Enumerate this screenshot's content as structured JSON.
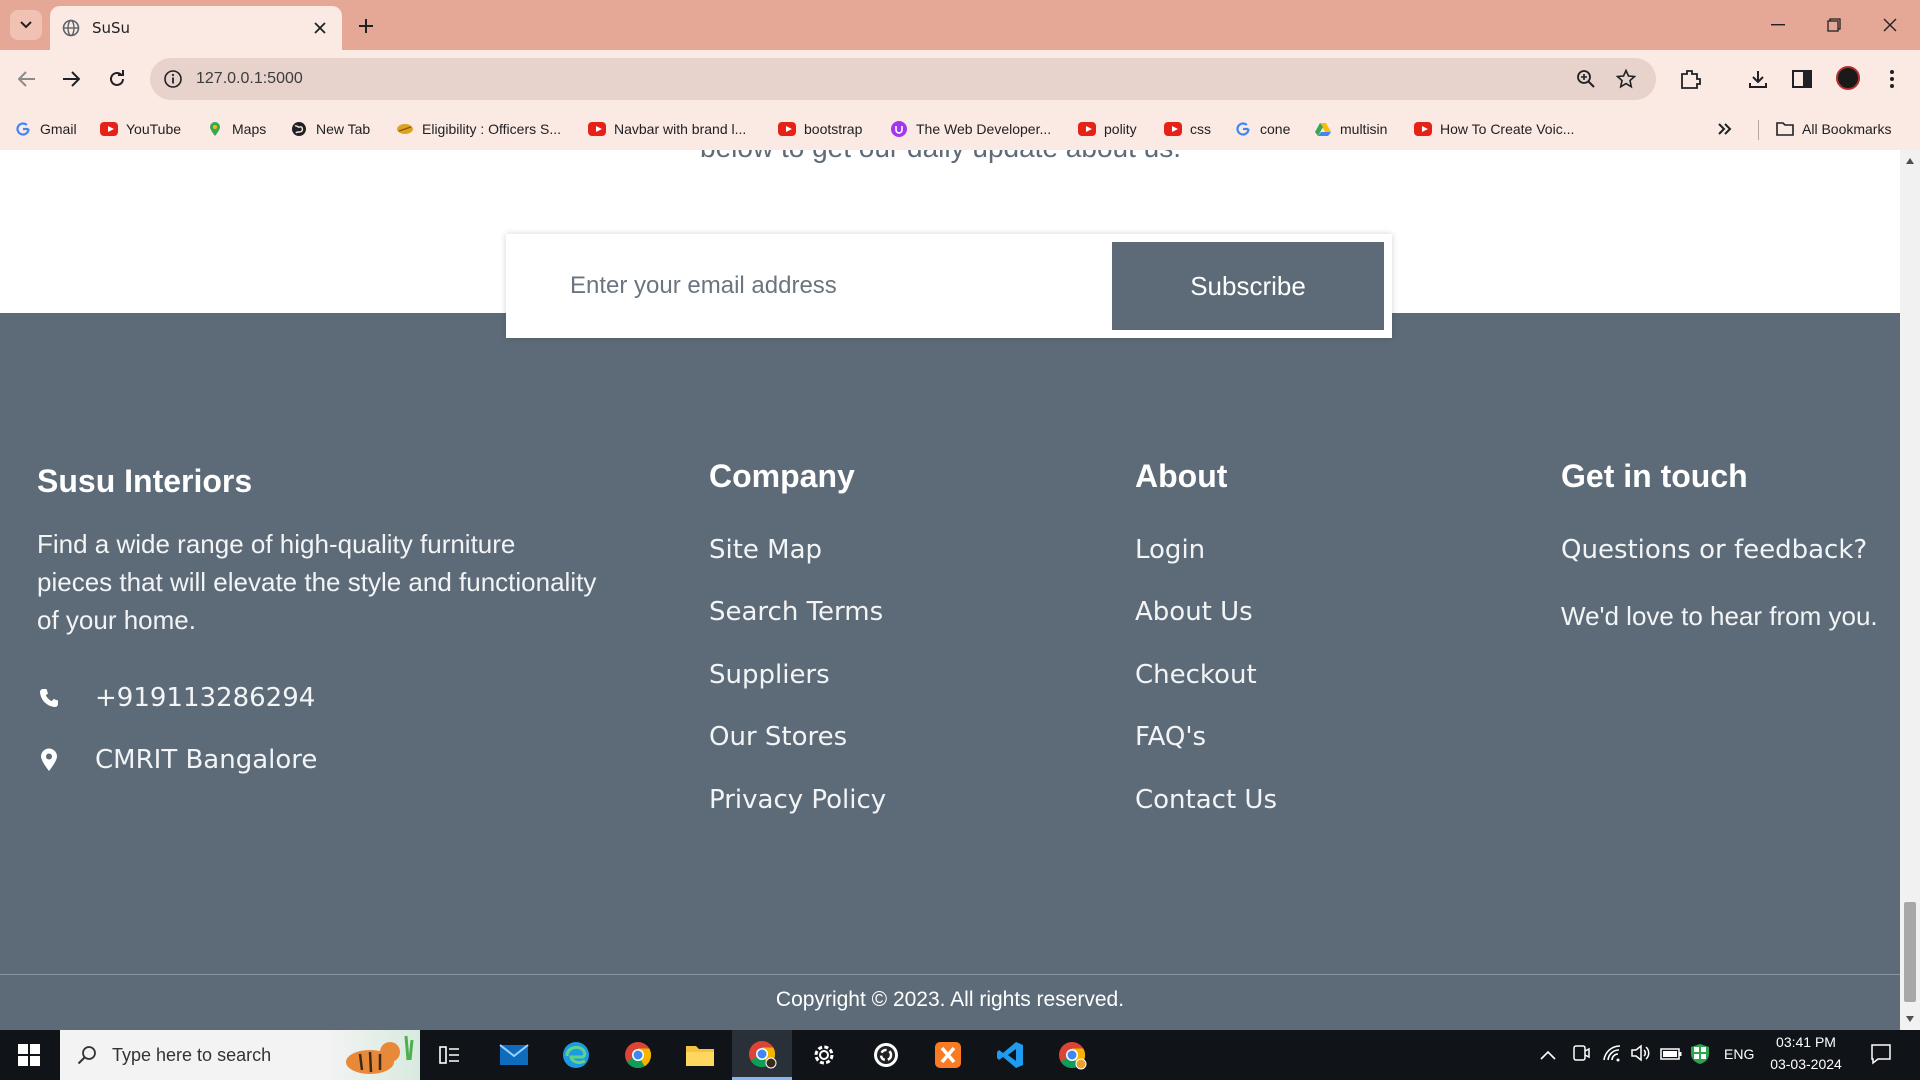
{
  "browser": {
    "tab_title": "SuSu",
    "url": "127.0.0.1:5000",
    "bookmarks": [
      "Gmail",
      "YouTube",
      "Maps",
      "New Tab",
      "Eligibility : Officers S...",
      "Navbar with brand l...",
      "bootstrap",
      "The Web Developer...",
      "polity",
      "css",
      "cone",
      "multisin",
      "How To Create Voic..."
    ],
    "all_bookmarks": "All Bookmarks"
  },
  "page": {
    "partial_text": "below to get our daily update about us.",
    "newsletter": {
      "placeholder": "Enter your email address",
      "button": "Subscribe"
    },
    "brand": {
      "title": "Susu Interiors",
      "description": "Find a wide range of high-quality furniture pieces that will elevate the style and functionality of your home.",
      "phone": "+919113286294",
      "location": "CMRIT Bangalore"
    },
    "company": {
      "title": "Company",
      "links": [
        "Site Map",
        "Search Terms",
        "Suppliers",
        "Our Stores",
        "Privacy Policy"
      ]
    },
    "about": {
      "title": "About",
      "links": [
        "Login",
        "About Us",
        "Checkout",
        "FAQ's",
        "Contact Us"
      ]
    },
    "contact": {
      "title": "Get in touch",
      "lines": [
        "Questions or feedback?",
        "We'd love to hear from you."
      ]
    },
    "copyright": "Copyright © 2023. All rights reserved."
  },
  "taskbar": {
    "search_placeholder": "Type here to search",
    "language": "ENG",
    "time": "03:41 PM",
    "date": "03-03-2024"
  },
  "colors": {
    "footer": "#5d6b78",
    "tab_strip": "#e5a896",
    "toolbar": "#fbe9e3"
  }
}
